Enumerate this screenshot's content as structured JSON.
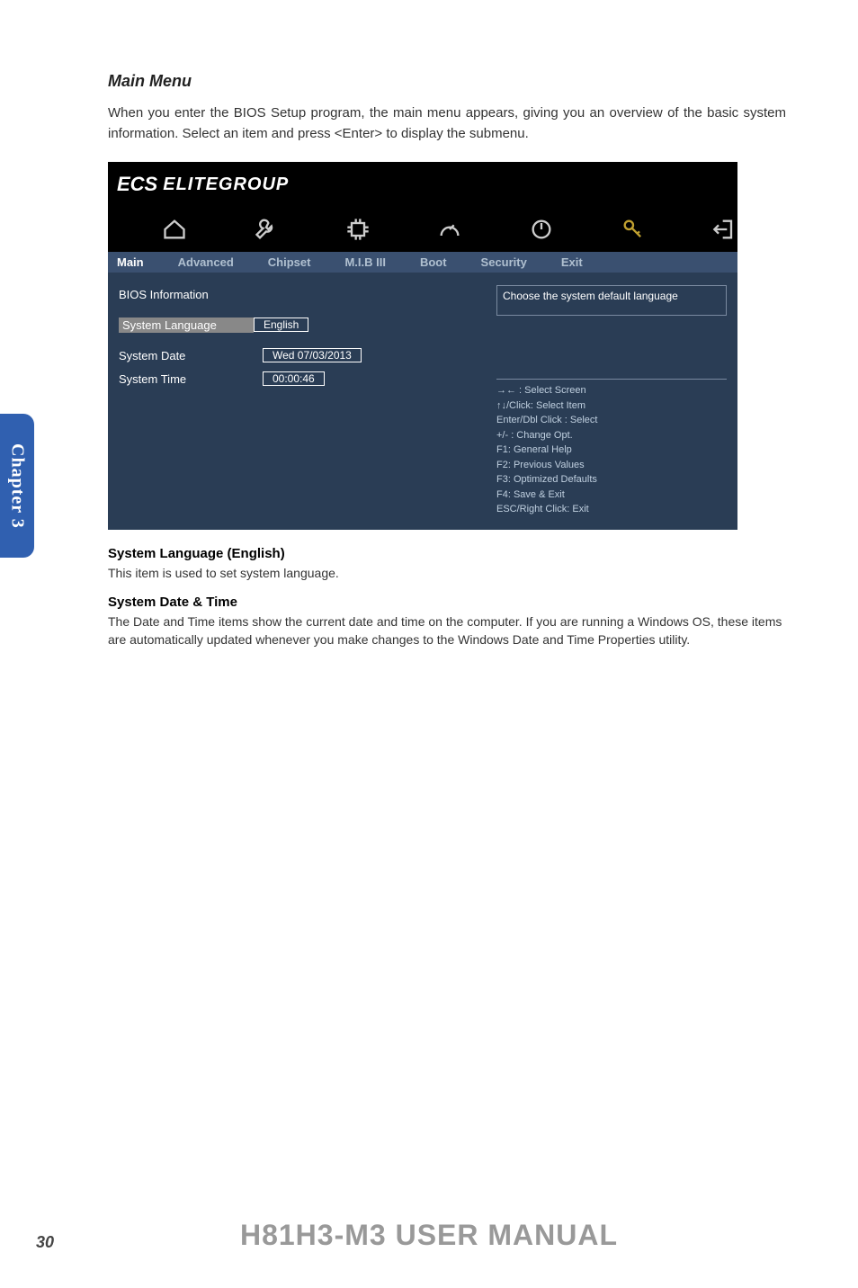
{
  "chapterTab": "Chapter 3",
  "sectionTitle": "Main Menu",
  "intro": "When you enter the BIOS Setup program, the main menu appears, giving you an overview of the basic system information. Select an item and press <Enter> to display the submenu.",
  "bios": {
    "brand": "ELITEGROUP",
    "tabs": [
      "Main",
      "Advanced",
      "Chipset",
      "M.I.B III",
      "Boot",
      "Security",
      "Exit"
    ],
    "activeTab": "Main",
    "leftRows": {
      "biosInfo": "BIOS Information",
      "sysLangLabel": "System Language",
      "sysLangValue": "English",
      "sysDateLabel": "System Date",
      "sysDateValue": "Wed 07/03/2013",
      "sysTimeLabel": "System Time",
      "sysTimeValue": "00:00:46"
    },
    "rightTop": "Choose the system default language",
    "help": {
      "l1": "→←   : Select Screen",
      "l2": "↑↓/Click: Select Item",
      "l3": "Enter/Dbl Click : Select",
      "l4": "+/- : Change Opt.",
      "l5": "F1: General Help",
      "l6": "F2: Previous Values",
      "l7": "F3: Optimized Defaults",
      "l8": "F4: Save & Exit",
      "l9": "ESC/Right Click: Exit"
    }
  },
  "sections": {
    "s1h": "System Language (English)",
    "s1t": "This item is used to set system language.",
    "s2h": "System Date & Time",
    "s2t": "The Date and Time items show the current date and time on the computer. If you are running a Windows OS, these items are automatically updated whenever you make changes to the Windows Date and Time Properties utility."
  },
  "footer": "H81H3-M3 USER MANUAL",
  "pageNum": "30"
}
